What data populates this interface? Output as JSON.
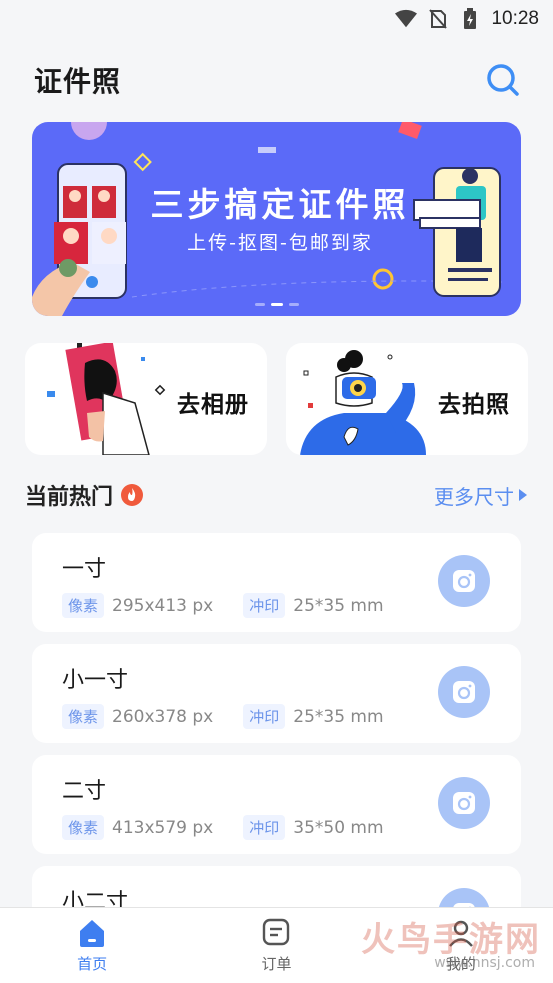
{
  "status_bar": {
    "time": "10:28",
    "icons": [
      "wifi-icon",
      "no-sim-icon",
      "battery-charging-icon"
    ]
  },
  "header": {
    "title": "证件照",
    "search_icon": "search-icon"
  },
  "banner": {
    "title": "三步搞定证件照",
    "subtitle": "上传-抠图-包邮到家",
    "background": "#5b6af8",
    "slide_count": 3,
    "active_slide": 2
  },
  "actions": {
    "album_label": "去相册",
    "camera_label": "去拍照"
  },
  "section": {
    "title": "当前热门",
    "hot_icon": "fire-icon",
    "more_label": "更多尺寸"
  },
  "sizes": [
    {
      "name": "一寸",
      "pixel_tag": "像素",
      "pixels": "295x413 px",
      "print_tag": "冲印",
      "print": "25*35 mm"
    },
    {
      "name": "小一寸",
      "pixel_tag": "像素",
      "pixels": "260x378 px",
      "print_tag": "冲印",
      "print": "25*35 mm"
    },
    {
      "name": "二寸",
      "pixel_tag": "像素",
      "pixels": "413x579 px",
      "print_tag": "冲印",
      "print": "35*50 mm"
    },
    {
      "name": "小二寸"
    }
  ],
  "nav": {
    "items": [
      {
        "label": "首页",
        "icon": "home-icon",
        "active": true
      },
      {
        "label": "订单",
        "icon": "order-icon",
        "active": false
      },
      {
        "label": "我的",
        "icon": "profile-icon",
        "active": false
      }
    ]
  },
  "watermark": {
    "text": "火鸟手游网",
    "url": "www.hnsj.com"
  },
  "colors": {
    "accent": "#3e7ef0",
    "camera_button": "#a9c4f7",
    "tag_text": "#6d95ea",
    "hot": "#f05a3c"
  }
}
